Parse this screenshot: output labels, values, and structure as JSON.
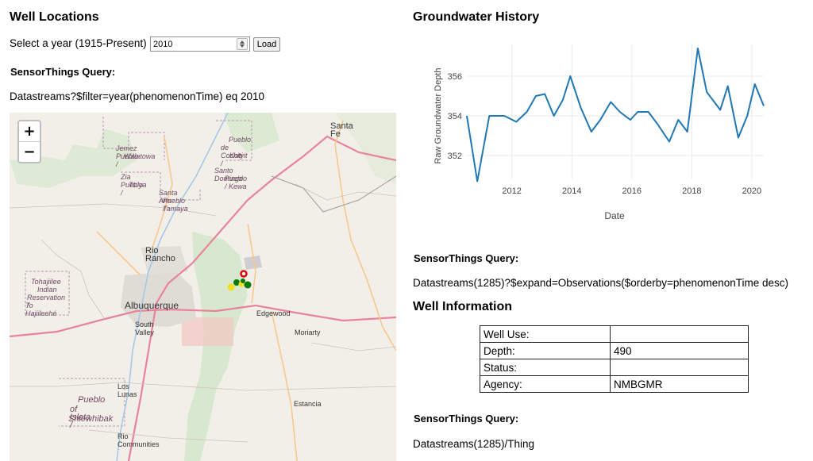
{
  "left": {
    "title": "Well Locations",
    "year_label": "Select a year (1915-Present)",
    "year_value": "2010",
    "load_label": "Load",
    "query_heading": "SensorThings Query:",
    "query_text": "Datastreams?$filter=year(phenomenonTime) eq 2010"
  },
  "map": {
    "zoom_in": "+",
    "zoom_out": "−",
    "places": {
      "santa_fe": "Santa Fe",
      "jemez_1": "Jemez Pueblo /",
      "jemez_2": "Walatowa",
      "cochiti_1": "Pueblo",
      "cochiti_2": "de Cochiti /",
      "cochiti_3": "Kotyit",
      "domingo_1": "Santo Domingo",
      "domingo_2": "Pueblo /",
      "domingo_3": "Kewa",
      "zia_1": "Zia Pueblo /",
      "zia_2": "Tsi'ya",
      "santa_ana_1": "Santa Ana",
      "santa_ana_2": "Pueblo /",
      "santa_ana_3": "Tamaya",
      "rio_rancho": "Rio Rancho",
      "tohajiilee_1": "Tohajiilee",
      "tohajiilee_2": "Indian",
      "tohajiilee_3": "Reservation /",
      "tohajiilee_4": "To Hajiileehé",
      "albuquerque": "Albuquerque",
      "south_valley": "South Valley",
      "edgewood": "Edgewood",
      "moriarty": "Moriarty",
      "los_lunas": "Los Lunas",
      "isleta_1": "Pueblo",
      "isleta_2": "of Isleta /",
      "isleta_3": "Shiewhibak",
      "estancia": "Estancia",
      "rio_communities": "Rio Communities"
    },
    "colors": {
      "red": "#e00000",
      "green": "#0a7a0a",
      "yellow": "#f0e020"
    }
  },
  "right": {
    "title": "Groundwater History",
    "query_heading_1": "SensorThings Query:",
    "query_text_1": "Datastreams(1285)?$expand=Observations($orderby=phenomenonTime desc)",
    "info_title": "Well Information",
    "query_heading_2": "SensorThings Query:",
    "query_text_2": "Datastreams(1285)/Thing"
  },
  "well_info": [
    {
      "key": "Well Use:",
      "value": ""
    },
    {
      "key": "Depth:",
      "value": "490"
    },
    {
      "key": "Status:",
      "value": ""
    },
    {
      "key": "Agency:",
      "value": "NMBGMR"
    }
  ],
  "chart_data": {
    "type": "line",
    "xlabel": "Date",
    "ylabel": "Raw Groundwater Depth",
    "xlim": [
      2010.5,
      2020.4
    ],
    "ylim": [
      350.8,
      357.6
    ],
    "x_ticks": [
      2012,
      2014,
      2016,
      2018,
      2020
    ],
    "y_ticks": [
      352,
      354,
      356
    ],
    "x_tick_labels": [
      "2012",
      "2014",
      "2016",
      "2018",
      "2020"
    ],
    "y_tick_labels": [
      "352",
      "354",
      "356"
    ],
    "line_color": "#1f77b4",
    "grid": true,
    "x": [
      2010.5,
      2010.85,
      2011.25,
      2011.75,
      2012.15,
      2012.5,
      2012.8,
      2013.1,
      2013.4,
      2013.7,
      2013.95,
      2014.3,
      2014.65,
      2014.95,
      2015.3,
      2015.6,
      2015.95,
      2016.2,
      2016.55,
      2016.85,
      2017.25,
      2017.55,
      2017.85,
      2018.2,
      2018.5,
      2018.95,
      2019.2,
      2019.55,
      2019.85,
      2020.1,
      2020.4
    ],
    "y": [
      354.0,
      350.7,
      354.0,
      354.0,
      353.7,
      354.2,
      355.0,
      355.1,
      354.0,
      354.8,
      356.0,
      354.4,
      353.2,
      353.8,
      354.7,
      354.2,
      353.8,
      354.2,
      354.2,
      353.6,
      352.7,
      353.8,
      353.2,
      357.4,
      355.2,
      354.3,
      355.5,
      352.9,
      354.0,
      355.6,
      354.5
    ]
  }
}
